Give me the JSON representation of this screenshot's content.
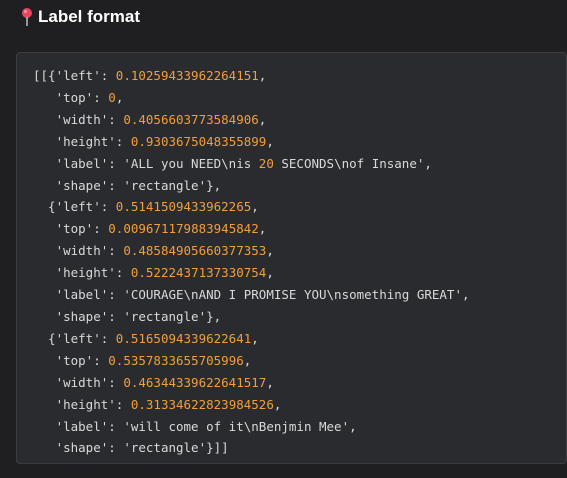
{
  "section": {
    "icon": "pushpin-icon",
    "title": "Label format"
  },
  "code": {
    "lines": [
      [
        {
          "t": "p",
          "v": "[[{"
        },
        {
          "t": "s",
          "v": "'left'"
        },
        {
          "t": "p",
          "v": ": "
        },
        {
          "t": "n",
          "v": "0.10259433962264151"
        },
        {
          "t": "p",
          "v": ","
        }
      ],
      [
        {
          "t": "p",
          "v": "   "
        },
        {
          "t": "s",
          "v": "'top'"
        },
        {
          "t": "p",
          "v": ": "
        },
        {
          "t": "n",
          "v": "0"
        },
        {
          "t": "p",
          "v": ","
        }
      ],
      [
        {
          "t": "p",
          "v": "   "
        },
        {
          "t": "s",
          "v": "'width'"
        },
        {
          "t": "p",
          "v": ": "
        },
        {
          "t": "n",
          "v": "0.4056603773584906"
        },
        {
          "t": "p",
          "v": ","
        }
      ],
      [
        {
          "t": "p",
          "v": "   "
        },
        {
          "t": "s",
          "v": "'height'"
        },
        {
          "t": "p",
          "v": ": "
        },
        {
          "t": "n",
          "v": "0.9303675048355899"
        },
        {
          "t": "p",
          "v": ","
        }
      ],
      [
        {
          "t": "p",
          "v": "   "
        },
        {
          "t": "s",
          "v": "'label'"
        },
        {
          "t": "p",
          "v": ": "
        },
        {
          "t": "s",
          "v": "'ALL you NEED\\nis "
        },
        {
          "t": "n",
          "v": "20"
        },
        {
          "t": "s",
          "v": " SECONDS\\nof Insane'"
        },
        {
          "t": "p",
          "v": ","
        }
      ],
      [
        {
          "t": "p",
          "v": "   "
        },
        {
          "t": "s",
          "v": "'shape'"
        },
        {
          "t": "p",
          "v": ": "
        },
        {
          "t": "s",
          "v": "'rectangle'"
        },
        {
          "t": "p",
          "v": "},"
        }
      ],
      [
        {
          "t": "p",
          "v": "  {"
        },
        {
          "t": "s",
          "v": "'left'"
        },
        {
          "t": "p",
          "v": ": "
        },
        {
          "t": "n",
          "v": "0.5141509433962265"
        },
        {
          "t": "p",
          "v": ","
        }
      ],
      [
        {
          "t": "p",
          "v": "   "
        },
        {
          "t": "s",
          "v": "'top'"
        },
        {
          "t": "p",
          "v": ": "
        },
        {
          "t": "n",
          "v": "0.009671179883945842"
        },
        {
          "t": "p",
          "v": ","
        }
      ],
      [
        {
          "t": "p",
          "v": "   "
        },
        {
          "t": "s",
          "v": "'width'"
        },
        {
          "t": "p",
          "v": ": "
        },
        {
          "t": "n",
          "v": "0.48584905660377353"
        },
        {
          "t": "p",
          "v": ","
        }
      ],
      [
        {
          "t": "p",
          "v": "   "
        },
        {
          "t": "s",
          "v": "'height'"
        },
        {
          "t": "p",
          "v": ": "
        },
        {
          "t": "n",
          "v": "0.5222437137330754"
        },
        {
          "t": "p",
          "v": ","
        }
      ],
      [
        {
          "t": "p",
          "v": "   "
        },
        {
          "t": "s",
          "v": "'label'"
        },
        {
          "t": "p",
          "v": ": "
        },
        {
          "t": "s",
          "v": "'COURAGE\\nAND I PROMISE YOU\\nsomething GREAT'"
        },
        {
          "t": "p",
          "v": ","
        }
      ],
      [
        {
          "t": "p",
          "v": "   "
        },
        {
          "t": "s",
          "v": "'shape'"
        },
        {
          "t": "p",
          "v": ": "
        },
        {
          "t": "s",
          "v": "'rectangle'"
        },
        {
          "t": "p",
          "v": "},"
        }
      ],
      [
        {
          "t": "p",
          "v": "  {"
        },
        {
          "t": "s",
          "v": "'left'"
        },
        {
          "t": "p",
          "v": ": "
        },
        {
          "t": "n",
          "v": "0.5165094339622641"
        },
        {
          "t": "p",
          "v": ","
        }
      ],
      [
        {
          "t": "p",
          "v": "   "
        },
        {
          "t": "s",
          "v": "'top'"
        },
        {
          "t": "p",
          "v": ": "
        },
        {
          "t": "n",
          "v": "0.5357833655705996"
        },
        {
          "t": "p",
          "v": ","
        }
      ],
      [
        {
          "t": "p",
          "v": "   "
        },
        {
          "t": "s",
          "v": "'width'"
        },
        {
          "t": "p",
          "v": ": "
        },
        {
          "t": "n",
          "v": "0.46344339622641517"
        },
        {
          "t": "p",
          "v": ","
        }
      ],
      [
        {
          "t": "p",
          "v": "   "
        },
        {
          "t": "s",
          "v": "'height'"
        },
        {
          "t": "p",
          "v": ": "
        },
        {
          "t": "n",
          "v": "0.31334622823984526"
        },
        {
          "t": "p",
          "v": ","
        }
      ],
      [
        {
          "t": "p",
          "v": "   "
        },
        {
          "t": "s",
          "v": "'label'"
        },
        {
          "t": "p",
          "v": ": "
        },
        {
          "t": "s",
          "v": "'will come of it\\nBenjmin Mee'"
        },
        {
          "t": "p",
          "v": ","
        }
      ],
      [
        {
          "t": "p",
          "v": "   "
        },
        {
          "t": "s",
          "v": "'shape'"
        },
        {
          "t": "p",
          "v": ": "
        },
        {
          "t": "s",
          "v": "'rectangle'"
        },
        {
          "t": "p",
          "v": "}]]"
        }
      ]
    ]
  },
  "colors": {
    "background": "#1f1f21",
    "panel": "#2a2b2e",
    "number": "#f29e3d",
    "text": "#d9d9d9",
    "pin": "#e8455f"
  }
}
